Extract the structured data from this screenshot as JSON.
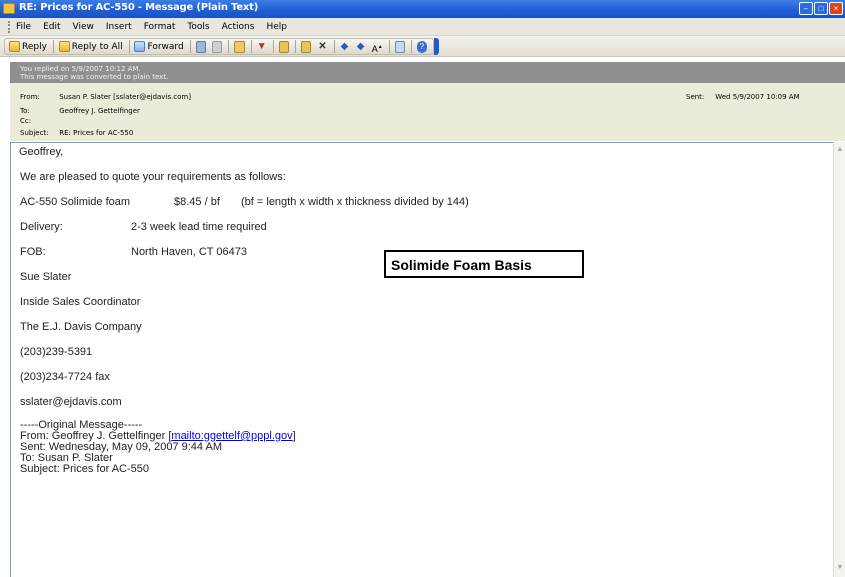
{
  "window": {
    "title": "RE: Prices for AC-550 - Message (Plain Text)"
  },
  "menu": [
    "File",
    "Edit",
    "View",
    "Insert",
    "Format",
    "Tools",
    "Actions",
    "Help"
  ],
  "toolbar": {
    "reply": "Reply",
    "reply_all": "Reply to All",
    "forward": "Forward",
    "font_size": "A"
  },
  "infobar": {
    "line1": "You replied on 5/9/2007 10:12 AM.",
    "line2": "This message was converted to plain text."
  },
  "header": {
    "from_label": "From:",
    "from_value": "Susan P. Slater [sslater@ejdavis.com]",
    "to_label": "To:",
    "to_value": "Geoffrey J. Gettelfinger",
    "cc_label": "Cc:",
    "cc_value": "",
    "subject_label": "Subject:",
    "subject_value": "RE: Prices for AC-550",
    "sent_label": "Sent:",
    "sent_value": "Wed 5/9/2007 10:09 AM"
  },
  "body": {
    "greeting": "Geoffrey,",
    "intro": "We are pleased to quote your requirements as follows:",
    "product_name": "AC-550 Solimide foam",
    "product_price": "$8.45 / bf",
    "product_note": "(bf = length x width x thickness divided by 144)",
    "delivery_label": "Delivery:",
    "delivery_value": "2-3 week lead time required",
    "fob_label": "FOB:",
    "fob_value": "North Haven, CT  06473",
    "signature_name": "Sue Slater",
    "signature_title": "Inside Sales Coordinator",
    "signature_company": "The E.J. Davis Company",
    "phone": "(203)239-5391",
    "fax": "(203)234-7724 fax",
    "email": "sslater@ejdavis.com"
  },
  "original_message": {
    "separator": "-----Original Message-----",
    "from_prefix": "From: Geoffrey J. Gettelfinger [",
    "from_link": "mailto:ggettelf@pppl.gov",
    "from_suffix": "]",
    "sent": "Sent: Wednesday, May 09, 2007 9:44 AM",
    "to": "To: Susan P. Slater",
    "subject": "Subject: Prices for AC-550"
  },
  "callout": {
    "text": "Solimide Foam Basis"
  }
}
